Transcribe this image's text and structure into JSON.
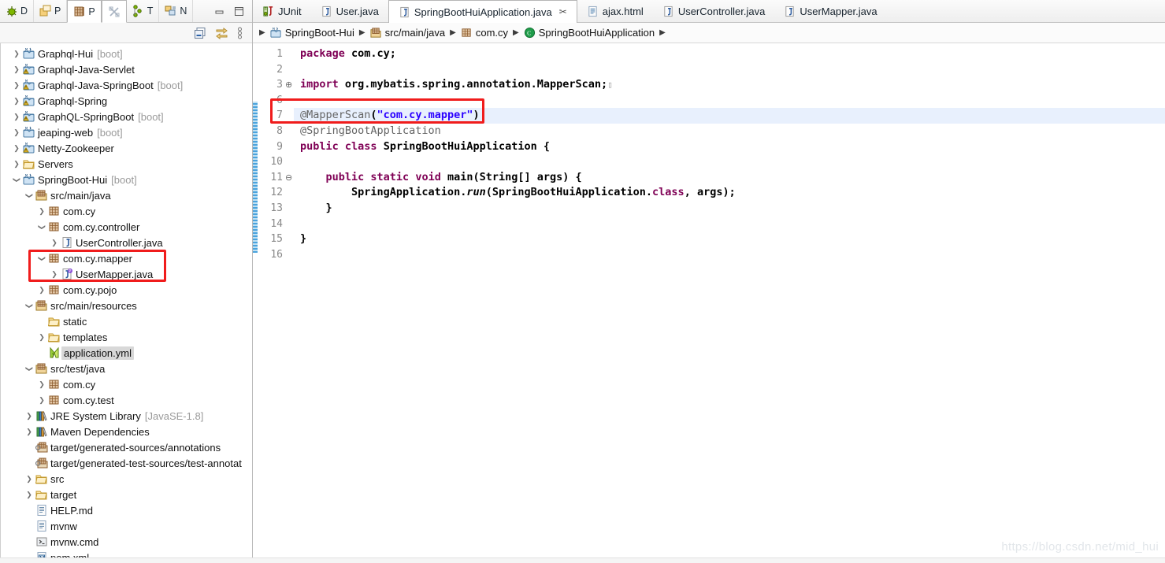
{
  "view_tabs": [
    {
      "icon": "debug-icon",
      "label": "D",
      "active": false
    },
    {
      "icon": "package-explorer-icon",
      "label": "P",
      "active": false
    },
    {
      "icon": "project-explorer-icon",
      "label": "P",
      "active": true
    },
    {
      "icon": "broken-link-icon",
      "label": "",
      "active": true
    },
    {
      "icon": "type-hierarchy-icon",
      "label": "T",
      "active": false
    },
    {
      "icon": "navigator-icon",
      "label": "N",
      "active": false
    }
  ],
  "window_controls": {
    "minimize": "minimize-icon",
    "maximize": "maximize-icon"
  },
  "explorer_toolbar": [
    {
      "icon": "collapse-all-icon",
      "name": "collapse-all-button"
    },
    {
      "icon": "link-with-editor-icon",
      "name": "link-with-editor-button"
    },
    {
      "icon": "view-menu-icon",
      "name": "view-menu-button"
    }
  ],
  "tree": [
    {
      "indent": 0,
      "twist": "collapsed",
      "icon": "maven-project-icon",
      "label": "Graphql-Hui",
      "suffix": "[boot]"
    },
    {
      "indent": 0,
      "twist": "collapsed",
      "icon": "maven-project-warn-icon",
      "label": "Graphql-Java-Servlet",
      "suffix": ""
    },
    {
      "indent": 0,
      "twist": "collapsed",
      "icon": "maven-project-warn-icon",
      "label": "Graphql-Java-SpringBoot",
      "suffix": "[boot]"
    },
    {
      "indent": 0,
      "twist": "collapsed",
      "icon": "maven-project-warn-icon",
      "label": "Graphql-Spring",
      "suffix": ""
    },
    {
      "indent": 0,
      "twist": "collapsed",
      "icon": "maven-project-warn-icon",
      "label": "GraphQL-SpringBoot",
      "suffix": "[boot]"
    },
    {
      "indent": 0,
      "twist": "collapsed",
      "icon": "maven-project-icon",
      "label": "jeaping-web",
      "suffix": "[boot]"
    },
    {
      "indent": 0,
      "twist": "collapsed",
      "icon": "maven-project-warn-icon",
      "label": "Netty-Zookeeper",
      "suffix": ""
    },
    {
      "indent": 0,
      "twist": "collapsed",
      "icon": "folder-icon",
      "label": "Servers",
      "suffix": ""
    },
    {
      "indent": 0,
      "twist": "expanded",
      "icon": "maven-project-icon",
      "label": "SpringBoot-Hui",
      "suffix": "[boot]"
    },
    {
      "indent": 1,
      "twist": "expanded",
      "icon": "source-folder-icon",
      "label": "src/main/java",
      "suffix": ""
    },
    {
      "indent": 2,
      "twist": "collapsed",
      "icon": "package-icon",
      "label": "com.cy",
      "suffix": ""
    },
    {
      "indent": 2,
      "twist": "expanded",
      "icon": "package-icon",
      "label": "com.cy.controller",
      "suffix": ""
    },
    {
      "indent": 3,
      "twist": "collapsed",
      "icon": "java-file-icon",
      "label": "UserController.java",
      "suffix": ""
    },
    {
      "indent": 2,
      "twist": "expanded",
      "icon": "package-icon",
      "label": "com.cy.mapper",
      "suffix": ""
    },
    {
      "indent": 3,
      "twist": "collapsed",
      "icon": "java-interface-icon",
      "label": "UserMapper.java",
      "suffix": ""
    },
    {
      "indent": 2,
      "twist": "collapsed",
      "icon": "package-icon",
      "label": "com.cy.pojo",
      "suffix": ""
    },
    {
      "indent": 1,
      "twist": "expanded",
      "icon": "source-folder-icon",
      "label": "src/main/resources",
      "suffix": ""
    },
    {
      "indent": 2,
      "twist": "none",
      "icon": "folder-icon",
      "label": "static",
      "suffix": ""
    },
    {
      "indent": 2,
      "twist": "collapsed",
      "icon": "folder-icon",
      "label": "templates",
      "suffix": ""
    },
    {
      "indent": 2,
      "twist": "none",
      "icon": "yml-file-icon",
      "label": "application.yml",
      "suffix": "",
      "selected": true
    },
    {
      "indent": 1,
      "twist": "expanded",
      "icon": "source-folder-icon",
      "label": "src/test/java",
      "suffix": ""
    },
    {
      "indent": 2,
      "twist": "collapsed",
      "icon": "package-icon",
      "label": "com.cy",
      "suffix": ""
    },
    {
      "indent": 2,
      "twist": "collapsed",
      "icon": "package-icon",
      "label": "com.cy.test",
      "suffix": ""
    },
    {
      "indent": 1,
      "twist": "collapsed",
      "icon": "library-icon",
      "label": "JRE System Library",
      "suffix": "[JavaSE-1.8]"
    },
    {
      "indent": 1,
      "twist": "collapsed",
      "icon": "library-icon",
      "label": "Maven Dependencies",
      "suffix": ""
    },
    {
      "indent": 1,
      "twist": "none",
      "icon": "generated-source-folder-icon",
      "label": "target/generated-sources/annotations",
      "suffix": ""
    },
    {
      "indent": 1,
      "twist": "none",
      "icon": "generated-source-folder-icon",
      "label": "target/generated-test-sources/test-annotat",
      "suffix": ""
    },
    {
      "indent": 1,
      "twist": "collapsed",
      "icon": "folder-icon",
      "label": "src",
      "suffix": ""
    },
    {
      "indent": 1,
      "twist": "collapsed",
      "icon": "folder-icon",
      "label": "target",
      "suffix": ""
    },
    {
      "indent": 1,
      "twist": "none",
      "icon": "text-file-icon",
      "label": "HELP.md",
      "suffix": ""
    },
    {
      "indent": 1,
      "twist": "none",
      "icon": "text-file-icon",
      "label": "mvnw",
      "suffix": ""
    },
    {
      "indent": 1,
      "twist": "none",
      "icon": "cmd-file-icon",
      "label": "mvnw.cmd",
      "suffix": ""
    },
    {
      "indent": 1,
      "twist": "none",
      "icon": "maven-pom-icon",
      "label": "pom.xml",
      "suffix": ""
    }
  ],
  "editor_tabs": [
    {
      "icon": "junit-icon",
      "label": "JUnit",
      "active": false,
      "closable": false
    },
    {
      "icon": "java-file-icon",
      "label": "User.java",
      "active": false,
      "closable": false
    },
    {
      "icon": "java-file-icon",
      "label": "SpringBootHuiApplication.java",
      "active": true,
      "closable": true,
      "close_glyph": "✂"
    },
    {
      "icon": "html-file-icon",
      "label": "ajax.html",
      "active": false,
      "closable": false
    },
    {
      "icon": "java-file-icon",
      "label": "UserController.java",
      "active": false,
      "closable": false
    },
    {
      "icon": "java-file-icon",
      "label": "UserMapper.java",
      "active": false,
      "closable": false
    }
  ],
  "breadcrumb": [
    {
      "icon": "maven-project-icon",
      "label": "SpringBoot-Hui"
    },
    {
      "icon": "source-folder-icon",
      "label": "src/main/java"
    },
    {
      "icon": "package-icon",
      "label": "com.cy"
    },
    {
      "icon": "class-icon",
      "label": "SpringBootHuiApplication"
    }
  ],
  "code": {
    "line_numbers": [
      "1",
      "2",
      "3",
      "6",
      "7",
      "8",
      "9",
      "10",
      "11",
      "12",
      "13",
      "14",
      "15",
      "16"
    ],
    "fold_markers": {
      "2": "plus",
      "8": "minus"
    },
    "highlight_line_index": 4,
    "lines": [
      {
        "n": "1",
        "tokens": [
          {
            "t": "package ",
            "c": "k"
          },
          {
            "t": "com.cy;",
            "c": "pl"
          }
        ]
      },
      {
        "n": "2",
        "tokens": []
      },
      {
        "n": "3",
        "tokens": [
          {
            "t": "import ",
            "c": "k"
          },
          {
            "t": "org.mybatis.spring.annotation.MapperScan;",
            "c": "pl"
          },
          {
            "t": "▯",
            "c": "fold"
          }
        ]
      },
      {
        "n": "6",
        "tokens": []
      },
      {
        "n": "7",
        "tokens": [
          {
            "t": "@MapperScan",
            "c": "an"
          },
          {
            "t": "(",
            "c": "pn"
          },
          {
            "t": "\"com.cy.mapper\"",
            "c": "st"
          },
          {
            "t": ")",
            "c": "pn"
          }
        ]
      },
      {
        "n": "8",
        "tokens": [
          {
            "t": "@SpringBootApplication",
            "c": "an"
          }
        ]
      },
      {
        "n": "9",
        "tokens": [
          {
            "t": "public ",
            "c": "k"
          },
          {
            "t": "class ",
            "c": "k"
          },
          {
            "t": "SpringBootHuiApplication ",
            "c": "pl"
          },
          {
            "t": "{",
            "c": "pn"
          }
        ]
      },
      {
        "n": "10",
        "tokens": []
      },
      {
        "n": "11",
        "tokens": [
          {
            "t": "    ",
            "c": "pl"
          },
          {
            "t": "public ",
            "c": "k"
          },
          {
            "t": "static ",
            "c": "k"
          },
          {
            "t": "void ",
            "c": "k"
          },
          {
            "t": "main(String[] ",
            "c": "pl"
          },
          {
            "t": "args",
            "c": "arg"
          },
          {
            "t": ") {",
            "c": "pn"
          }
        ]
      },
      {
        "n": "12",
        "tokens": [
          {
            "t": "        SpringApplication.",
            "c": "pl"
          },
          {
            "t": "run",
            "c": "it"
          },
          {
            "t": "(SpringBootHuiApplication.",
            "c": "pl"
          },
          {
            "t": "class",
            "c": "k"
          },
          {
            "t": ", ",
            "c": "pn"
          },
          {
            "t": "args",
            "c": "arg"
          },
          {
            "t": ");",
            "c": "pn"
          }
        ]
      },
      {
        "n": "13",
        "tokens": [
          {
            "t": "    }",
            "c": "pn"
          }
        ]
      },
      {
        "n": "14",
        "tokens": []
      },
      {
        "n": "15",
        "tokens": [
          {
            "t": "}",
            "c": "pn"
          }
        ]
      },
      {
        "n": "16",
        "tokens": []
      }
    ]
  },
  "annotations": {
    "redbox_code_label": "highlight-mapperscan-annotation",
    "redbox_tree_label": "highlight-mapper-package"
  },
  "watermark": "https://blog.csdn.net/mid_hui",
  "colors": {
    "accent_red": "#f01c1c",
    "keyword": "#7f0055",
    "string": "#2a00ff",
    "annotation": "#646464",
    "highlight_line": "#e8f0fd",
    "suffix_gray": "#9a9a9a"
  }
}
